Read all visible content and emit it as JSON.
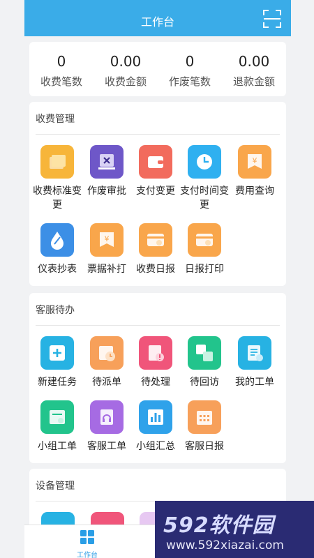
{
  "header": {
    "title": "工作台",
    "scan_icon": "scan-icon"
  },
  "stats": [
    {
      "value": "0",
      "label": "收费笔数"
    },
    {
      "value": "0.00",
      "label": "收费金额"
    },
    {
      "value": "0",
      "label": "作废笔数"
    },
    {
      "value": "0.00",
      "label": "退款金额"
    }
  ],
  "sections": {
    "billing": {
      "title": "收费管理",
      "items": [
        {
          "label": "收费标准变更",
          "icon": "document-stack-icon",
          "color": "#f7b53a"
        },
        {
          "label": "作废审批",
          "icon": "cancel-doc-icon",
          "color": "#6e57c8"
        },
        {
          "label": "支付变更",
          "icon": "wallet-icon",
          "color": "#f26b5d"
        },
        {
          "label": "支付时间变更",
          "icon": "clock-icon",
          "color": "#2fb0f0"
        },
        {
          "label": "费用查询",
          "icon": "yen-receipt-icon",
          "color": "#f9a64b"
        },
        {
          "label": "仪表抄表",
          "icon": "water-drop-icon",
          "color": "#3c8fe6"
        },
        {
          "label": "票据补打",
          "icon": "yen-receipt-icon",
          "color": "#f9a64b"
        },
        {
          "label": "收费日报",
          "icon": "yen-card-icon",
          "color": "#f9a64b"
        },
        {
          "label": "日报打印",
          "icon": "yen-card-icon",
          "color": "#f9a64b"
        }
      ]
    },
    "service": {
      "title": "客服待办",
      "items": [
        {
          "label": "新建任务",
          "icon": "plus-box-icon",
          "color": "#27b2e3"
        },
        {
          "label": "待派单",
          "icon": "calendar-clock-icon",
          "color": "#f7a05a"
        },
        {
          "label": "待处理",
          "icon": "alert-clipboard-icon",
          "color": "#f0557a"
        },
        {
          "label": "待回访",
          "icon": "squares-icon",
          "color": "#22c48c"
        },
        {
          "label": "我的工单",
          "icon": "user-doc-icon",
          "color": "#27b2e3"
        },
        {
          "label": "小组工单",
          "icon": "group-doc-icon",
          "color": "#22c48c"
        },
        {
          "label": "客服工单",
          "icon": "headset-icon",
          "color": "#a66be3"
        },
        {
          "label": "小组汇总",
          "icon": "bar-chart-icon",
          "color": "#2fa2ea"
        },
        {
          "label": "客服日报",
          "icon": "calendar-icon",
          "color": "#f7a05a"
        }
      ]
    },
    "device": {
      "title": "设备管理"
    }
  },
  "tabbar": {
    "workbench_label": "工作台",
    "workbench_color": "#2a9ee6"
  },
  "watermark": {
    "brand": "592软件园",
    "url": "www.592xiazai.com"
  }
}
